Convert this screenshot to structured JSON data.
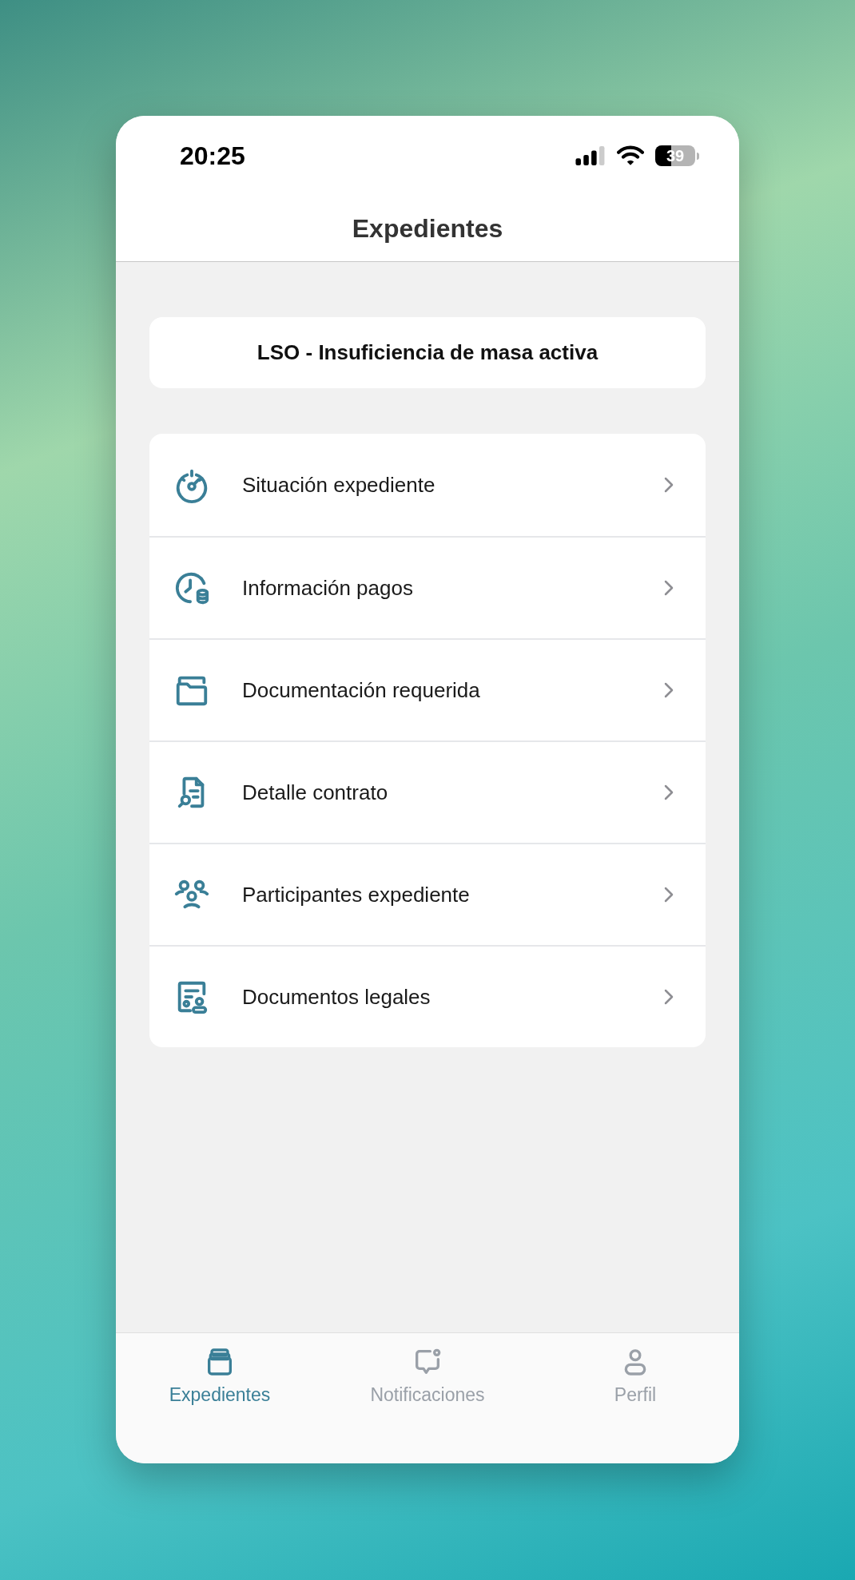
{
  "status_bar": {
    "time": "20:25",
    "battery": "39"
  },
  "header": {
    "title": "Expedientes"
  },
  "case_title": "LSO - Insuficiencia de masa activa",
  "menu": [
    {
      "label": "Situación expediente"
    },
    {
      "label": "Información pagos"
    },
    {
      "label": "Documentación requerida"
    },
    {
      "label": "Detalle contrato"
    },
    {
      "label": "Participantes expediente"
    },
    {
      "label": "Documentos legales"
    }
  ],
  "tabs": [
    {
      "label": "Expedientes",
      "selected": true
    },
    {
      "label": "Notificaciones",
      "selected": false
    },
    {
      "label": "Perfil",
      "selected": false
    }
  ]
}
